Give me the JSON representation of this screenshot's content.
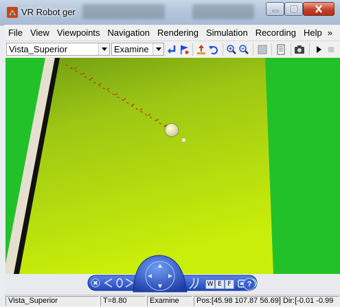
{
  "window": {
    "title": "VR Robot ger",
    "controls": [
      "minimize-icon",
      "maximize-icon",
      "close-icon"
    ]
  },
  "menubar": {
    "items": [
      "File",
      "View",
      "Viewpoints",
      "Navigation",
      "Rendering",
      "Simulation",
      "Recording",
      "Help"
    ],
    "overflow_glyph": "»"
  },
  "toolbar": {
    "viewpoint_select": {
      "value": "Vista_Superior"
    },
    "nav_mode_select": {
      "value": "Examine"
    },
    "icons": [
      "go-to-default-viewpoint-icon",
      "create-viewpoint-icon",
      "straighten-up-icon",
      "undo-move-icon",
      "zoom-in-icon",
      "zoom-out-icon",
      "toggle-wireframe-icon",
      "edit-icon",
      "capture-frame-icon",
      "play-icon",
      "stop-icon"
    ]
  },
  "scene": {
    "background_color": "#22c12a",
    "floor_color": "#a6d10d",
    "wall_color": "#e6dfcf"
  },
  "nav_panel": {
    "buttons": [
      "close-panel",
      "rotate-left",
      "rotate-right",
      "navigation-wheel",
      "wireframe-toggle",
      "headlight-toggle",
      "straighten-up",
      "home-viewpoint",
      "help"
    ],
    "labels": {
      "w": "W",
      "e": "E",
      "f": "F",
      "help": "?"
    }
  },
  "statusbar": {
    "viewpoint": "Vista_Superior",
    "time": "T=8.80",
    "nav_mode": "Examine",
    "position": "Pos:[45.98 107.87 56.69] Dir:[-0.01 -0.99"
  }
}
